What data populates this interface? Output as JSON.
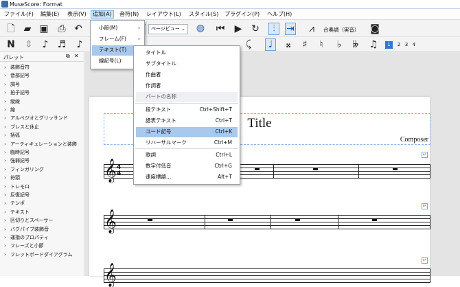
{
  "window": {
    "title": "MuseScore: Format"
  },
  "menubar": [
    "ファイル(F)",
    "編集(E)",
    "表示(V)",
    "追加(A)",
    "音符(N)",
    "レイアウト(L)",
    "スタイル(S)",
    "プラグイン(P)",
    "ヘルプ(H)"
  ],
  "toolbar": {
    "view_mode": "ページビュー",
    "transpose_label": "合奏調（実音）",
    "voices": [
      "1",
      "2",
      "3",
      "4"
    ]
  },
  "palette": {
    "title": "パレット",
    "items": [
      "装飾音符",
      "音部記号",
      "調号",
      "拍子記号",
      "縦線",
      "線",
      "アルペジオとグリッサンド",
      "ブレスと休止",
      "括弧",
      "アーティキュレーションと装飾",
      "臨時記号",
      "強弱記号",
      "フィンガリング",
      "符頭",
      "トレモロ",
      "反復記号",
      "テンポ",
      "テキスト",
      "区切りとスペーサー",
      "バグパイプ装飾音",
      "運指のプロパティ",
      "フレーズと小節",
      "フレットボードダイアグラム"
    ]
  },
  "add_menu": {
    "items": [
      {
        "label": "小節(M)",
        "submenu": true
      },
      {
        "label": "フレーム(F)",
        "submenu": true
      },
      {
        "label": "テキスト(T)",
        "submenu": true
      },
      {
        "label": "線記号(L)",
        "submenu": true
      }
    ]
  },
  "text_submenu": {
    "items": [
      {
        "label": "タイトル",
        "shortcut": ""
      },
      {
        "label": "サブタイトル",
        "shortcut": ""
      },
      {
        "label": "作曲者",
        "shortcut": ""
      },
      {
        "label": "作詞者",
        "shortcut": ""
      },
      {
        "label": "パートの名称",
        "shortcut": ""
      },
      {
        "label": "段テキスト",
        "shortcut": "Ctrl+Shift+T"
      },
      {
        "label": "譜表テキスト",
        "shortcut": "Ctrl+T"
      },
      {
        "label": "コード記号",
        "shortcut": "Ctrl+K"
      },
      {
        "label": "リハーサルマーク",
        "shortcut": "Ctrl+M"
      },
      {
        "label": "歌詞",
        "shortcut": "Ctrl+L"
      },
      {
        "label": "数字付低音",
        "shortcut": "Ctrl+G"
      },
      {
        "label": "速度標語...",
        "shortcut": "Alt+T"
      }
    ]
  },
  "score": {
    "title": "Title",
    "composer": "Composer",
    "time_signature": "4\n4"
  }
}
